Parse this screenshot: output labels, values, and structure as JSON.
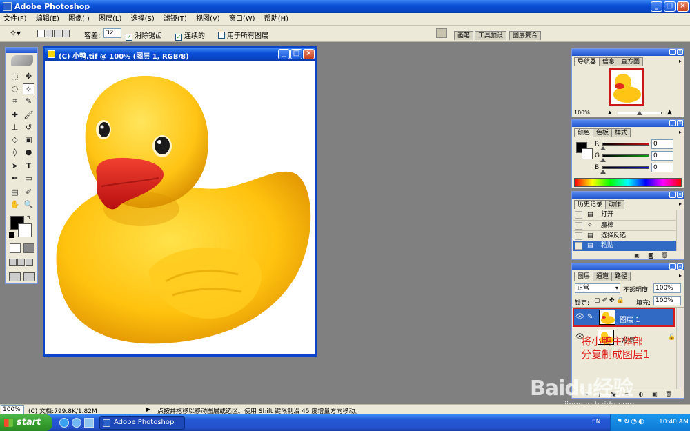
{
  "app": {
    "title": "Adobe Photoshop",
    "window_controls": [
      "_",
      "□",
      "×"
    ]
  },
  "menu": [
    "文件(F)",
    "编辑(E)",
    "图像(I)",
    "图层(L)",
    "选择(S)",
    "滤镜(T)",
    "视图(V)",
    "窗口(W)",
    "帮助(H)"
  ],
  "options_bar": {
    "tolerance_label": "容差:",
    "tolerance_value": "32",
    "antialias_label": "消除锯齿",
    "contiguous_label": "连续的",
    "all_layers_label": "用于所有图层",
    "palette_well_tabs": [
      "画笔",
      "工具预设",
      "图层复合"
    ]
  },
  "document": {
    "title": "(C) 小鸭.tif @ 100% (图层 1, RGB/8)"
  },
  "navigator_panel": {
    "tabs": [
      "导航器",
      "信息",
      "直方图"
    ],
    "zoom": "100%"
  },
  "color_panel": {
    "tabs": [
      "颜色",
      "色板",
      "样式"
    ],
    "channels": [
      {
        "label": "R",
        "value": "0"
      },
      {
        "label": "G",
        "value": "0"
      },
      {
        "label": "B",
        "value": "0"
      }
    ],
    "colors": {
      "red": "#cc1111",
      "green": "#11aa11",
      "blue": "#1111cc"
    }
  },
  "history_panel": {
    "tabs": [
      "历史记录",
      "动作"
    ],
    "items": [
      "打开",
      "魔棒",
      "选择反选",
      "粘贴"
    ],
    "selected_index": 3
  },
  "layers_panel": {
    "tabs": [
      "图层",
      "通道",
      "路径"
    ],
    "blend_mode": "正常",
    "opacity_label": "不透明度:",
    "opacity_value": "100%",
    "lock_label": "锁定:",
    "fill_label": "填充:",
    "fill_value": "100%",
    "layers": [
      {
        "name": "图层 1",
        "selected": true
      },
      {
        "name": "背景",
        "selected": false
      }
    ]
  },
  "annotation": {
    "line1": "将小鸭主体部",
    "line2": "分复制成图层1",
    "color": "#e0201c"
  },
  "status_bar": {
    "zoom": "100%",
    "doc_info": "(C) 文档:799.8K/1.82M",
    "hint": "点按并拖移以移动图层或选区。使用 Shift 键限制沿 45 度增量方向移动。"
  },
  "taskbar": {
    "start_label": "start",
    "task_label": "Adobe Photoshop",
    "lang": "EN",
    "clock": "10:40 AM"
  },
  "watermark": {
    "brand": "Baidu经验",
    "url": "jingyan.baidu.com"
  }
}
